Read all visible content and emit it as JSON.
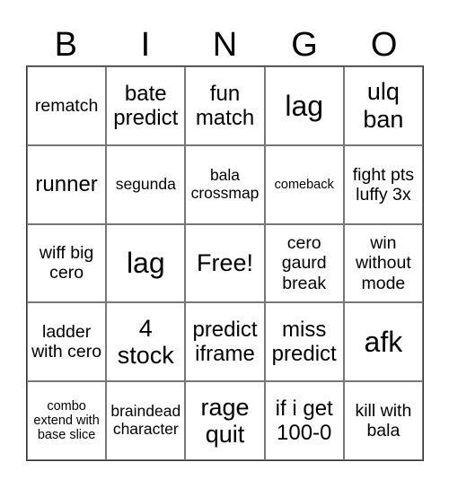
{
  "header": [
    "B",
    "I",
    "N",
    "G",
    "O"
  ],
  "cells": [
    "rematch",
    "bate predict",
    "fun match",
    "lag",
    "ulq ban",
    "runner",
    "segunda",
    "bala crossmap",
    "comeback",
    "fight pts luffy 3x",
    "wiff big cero",
    "lag",
    "Free!",
    "cero gaurd break",
    "win without mode",
    "ladder with cero",
    "4 stock",
    "predict iframe",
    "miss predict",
    "afk",
    "combo extend with base slice",
    "braindead character",
    "rage quit",
    "if i get 100-0",
    "kill with bala"
  ]
}
